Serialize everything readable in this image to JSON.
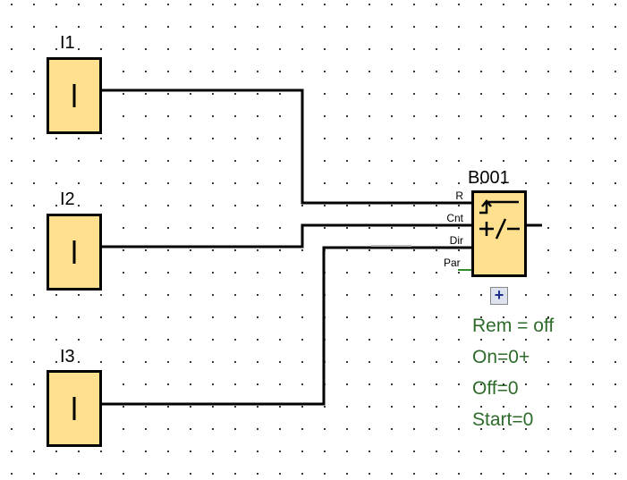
{
  "inputs": [
    {
      "label": "I1",
      "symbol": "I"
    },
    {
      "label": "I2",
      "symbol": "I"
    },
    {
      "label": "I3",
      "symbol": "I"
    }
  ],
  "block": {
    "label": "B001",
    "function": "up/down counter",
    "pins": [
      "R",
      "Cnt",
      "Dir",
      "Par"
    ],
    "expand_icon": "plus-icon"
  },
  "parameters": [
    "Rem = off",
    "On=0+",
    "Off=0",
    "Start=0"
  ],
  "colors": {
    "block_fill": "#ffe08f",
    "parameter_text": "#2e6b2a",
    "par_wire": "#2e8b2e"
  }
}
